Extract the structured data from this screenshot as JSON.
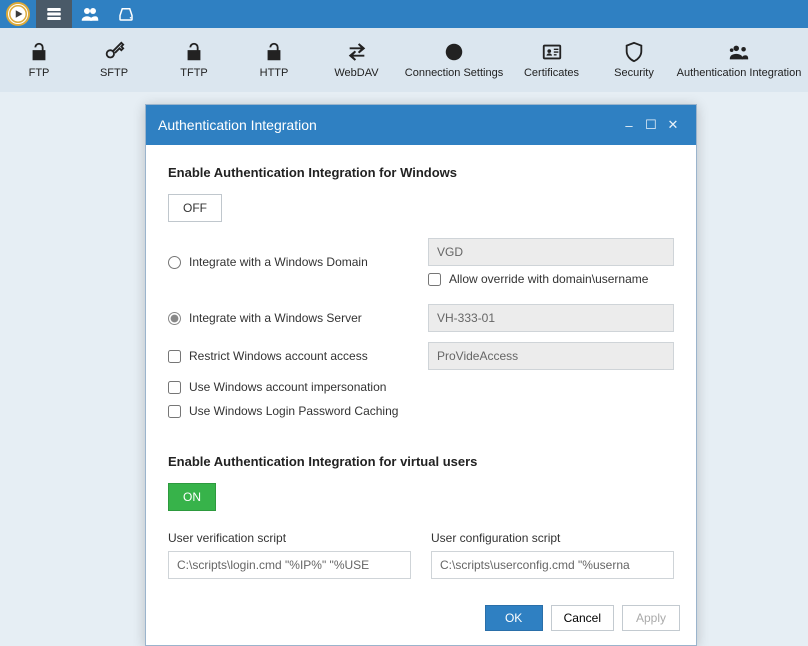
{
  "toolbar": {
    "items": [
      {
        "label": "FTP"
      },
      {
        "label": "SFTP"
      },
      {
        "label": "TFTP"
      },
      {
        "label": "HTTP"
      },
      {
        "label": "WebDAV"
      },
      {
        "label": "Connection Settings"
      },
      {
        "label": "Certificates"
      },
      {
        "label": "Security"
      },
      {
        "label": "Authentication Integration"
      }
    ]
  },
  "dialog": {
    "title": "Authentication Integration",
    "windows_heading": "Enable Authentication Integration for Windows",
    "off_label": "OFF",
    "opt_domain": "Integrate with a Windows Domain",
    "domain_value": "VGD",
    "allow_override": "Allow override with domain\\username",
    "opt_server": "Integrate with a Windows Server",
    "server_value": "VH-333-01",
    "restrict_access": "Restrict Windows account access",
    "restrict_value": "ProVideAccess",
    "impersonation": "Use Windows account impersonation",
    "pw_caching": "Use Windows Login Password Caching",
    "virtual_heading": "Enable Authentication Integration for virtual users",
    "on_label": "ON",
    "verify_label": "User verification script",
    "verify_value": "C:\\scripts\\login.cmd \"%IP%\" \"%USE",
    "config_label": "User configuration script",
    "config_value": "C:\\scripts\\userconfig.cmd \"%userna",
    "btn_ok": "OK",
    "btn_cancel": "Cancel",
    "btn_apply": "Apply"
  }
}
